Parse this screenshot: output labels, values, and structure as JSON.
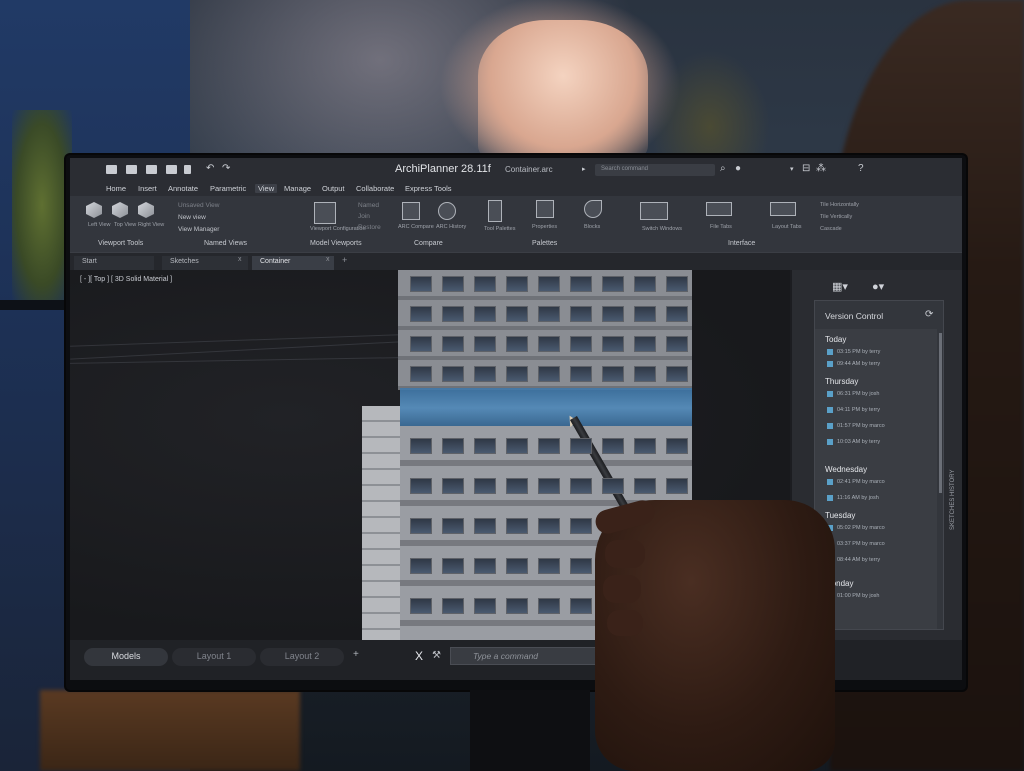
{
  "app": {
    "title": "ArchiPlanner 28.11f",
    "file_name": "Container.arc",
    "search_placeholder": "Search command"
  },
  "menu": [
    "Home",
    "Insert",
    "Annotate",
    "Parametric",
    "View",
    "Manage",
    "Output",
    "Collaborate",
    "Express Tools"
  ],
  "ribbon": {
    "viewport_tools": {
      "label": "Viewport Tools",
      "items": [
        "Left View",
        "Top View",
        "Right View"
      ]
    },
    "named_views": {
      "label": "Named Views",
      "items": [
        "Unsaved View",
        "New view",
        "View Manager"
      ]
    },
    "model_viewports": {
      "label": "Model Viewports",
      "items": [
        "Named",
        "Join",
        "Restore"
      ],
      "icon_label": "Viewport Configuration"
    },
    "compare": {
      "label": "Compare",
      "items": [
        "ARC Compare",
        "ARC History"
      ]
    },
    "palettes": {
      "label": "Palettes",
      "items": [
        "Tool Palettes",
        "Properties",
        "Blocks"
      ]
    },
    "interface": {
      "label": "Interface",
      "items": [
        "Switch Windows",
        "File Tabs",
        "Layout Tabs"
      ],
      "side_items": [
        "Tile Horizontally",
        "Tile Vertically",
        "Cascade"
      ]
    }
  },
  "file_tabs": [
    {
      "label": "Start"
    },
    {
      "label": "Sketches",
      "close": "x"
    },
    {
      "label": "Container",
      "close": "x"
    }
  ],
  "new_tab": "+",
  "viewport": {
    "label": "[ - ][ Top ] [ 3D Solid Material ]"
  },
  "version_control": {
    "title": "Version Control",
    "refresh_glyph": "⟳",
    "days": [
      {
        "day": "Today",
        "entries": [
          "03:15 PM by terry",
          "09:44 AM by terry"
        ]
      },
      {
        "day": "Thursday",
        "entries": [
          "06:31 PM by josh",
          "04:11 PM by terry",
          "01:57 PM by marco",
          "10:03 AM by terry"
        ]
      },
      {
        "day": "Wednesday",
        "entries": [
          "02:41 PM by marco",
          "11:16 AM by josh"
        ]
      },
      {
        "day": "Tuesday",
        "entries": [
          "05:02 PM by marco",
          "03:37 PM by marco",
          "08:44 AM by terry"
        ]
      },
      {
        "day": "Monday",
        "entries": [
          "01:00 PM by josh"
        ]
      }
    ],
    "side_label": "SKETCHES HISTORY"
  },
  "bottom": {
    "layout_tabs": [
      "Models",
      "Layout 1",
      "Layout 2"
    ],
    "add": "+",
    "close_glyph": "X",
    "command_placeholder": "Type a command"
  }
}
